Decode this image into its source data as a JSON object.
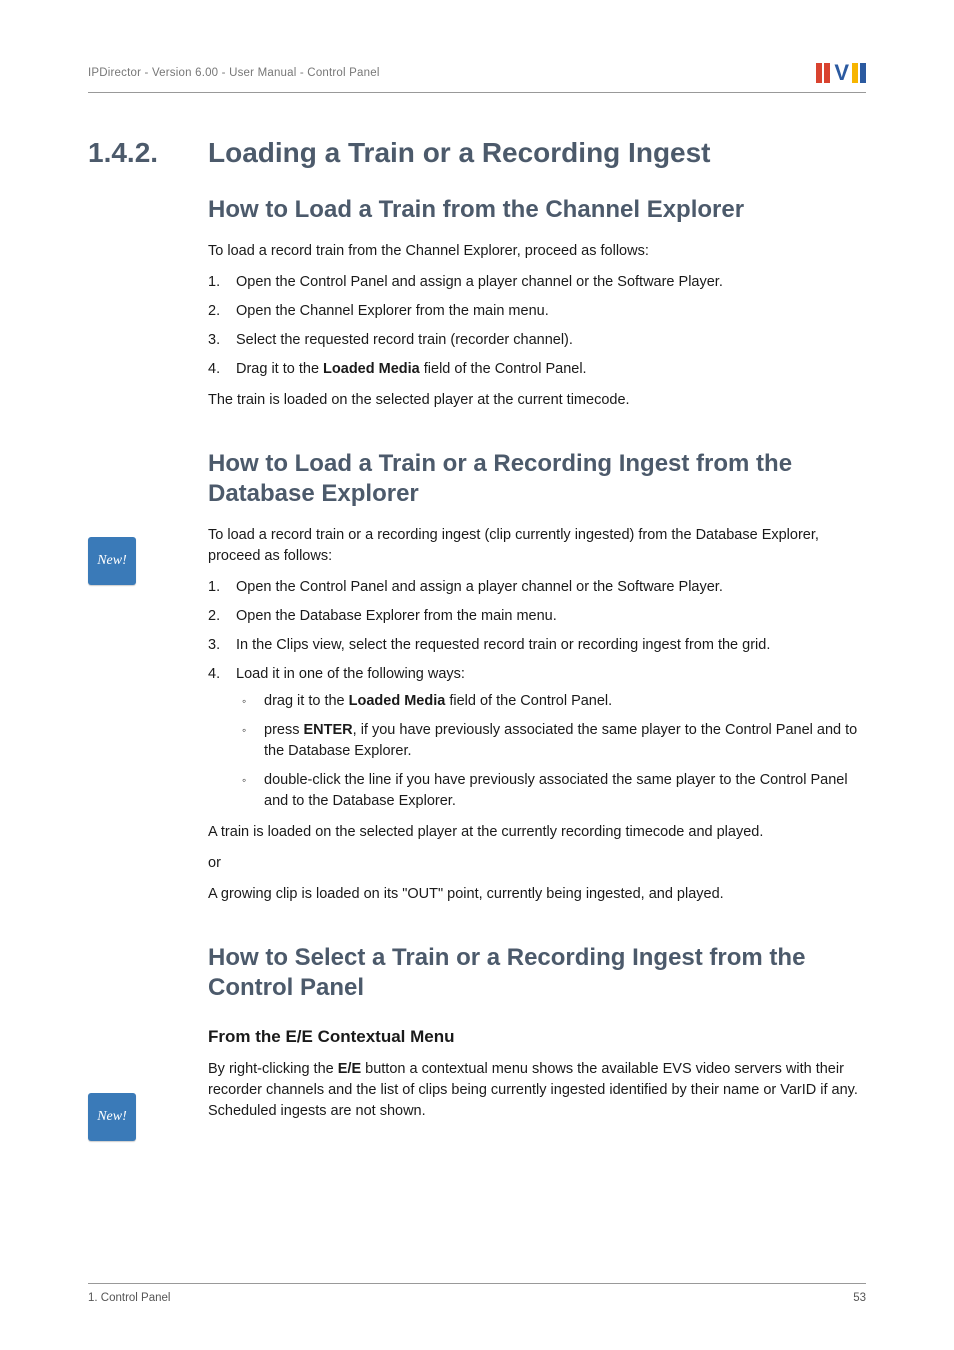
{
  "header": {
    "left": "IPDirector - Version 6.00 - User Manual - Control Panel"
  },
  "badge": {
    "label": "New!"
  },
  "section": {
    "number": "1.4.2.",
    "title": "Loading a Train or a Recording Ingest"
  },
  "h2a": "How to Load a Train from the Channel Explorer",
  "p1": "To load a record train from the Channel Explorer, proceed as follows:",
  "ol1": {
    "i1": "Open the Control Panel and assign a player channel or the Software Player.",
    "i2": "Open the Channel Explorer from the main menu.",
    "i3": "Select the requested record train (recorder channel).",
    "i4a": "Drag it to the ",
    "i4b": "Loaded Media",
    "i4c": " field of the Control Panel."
  },
  "p2": "The train is loaded on the selected player at the current timecode.",
  "h2b": "How to Load a Train or a Recording Ingest from the Database Explorer",
  "p3": "To load a record train or a recording ingest (clip currently ingested) from the Database Explorer, proceed as follows:",
  "ol2": {
    "i1": "Open the Control Panel and assign a player channel or the Software Player.",
    "i2": "Open the Database Explorer from the main menu.",
    "i3": "In the Clips view, select the requested record train or recording ingest from the grid.",
    "i4": "Load it in one of the following ways:"
  },
  "ul1": {
    "b1a": "drag it to the ",
    "b1b": "Loaded Media",
    "b1c": " field of the Control Panel.",
    "b2a": "press ",
    "b2b": "ENTER",
    "b2c": ", if you have previously associated the same player to the Control Panel and to the Database Explorer.",
    "b3": "double-click the line if you have previously associated the same player to the Control Panel and to the Database Explorer."
  },
  "p4": "A train is loaded on the selected player at the currently recording timecode and played.",
  "p5": "or",
  "p6": "A growing clip is loaded on its \"OUT\" point, currently being ingested, and played.",
  "h2c": "How to Select a Train or a Recording Ingest from the Control Panel",
  "h3a": "From the E/E Contextual Menu",
  "p7a": "By right-clicking the ",
  "p7b": "E/E",
  "p7c": " button a contextual menu shows the available EVS video servers with their recorder channels and the list of clips being currently ingested identified by their name or VarID if any. Scheduled ingests are not shown.",
  "footer": {
    "left": "1. Control Panel",
    "right": "53"
  }
}
